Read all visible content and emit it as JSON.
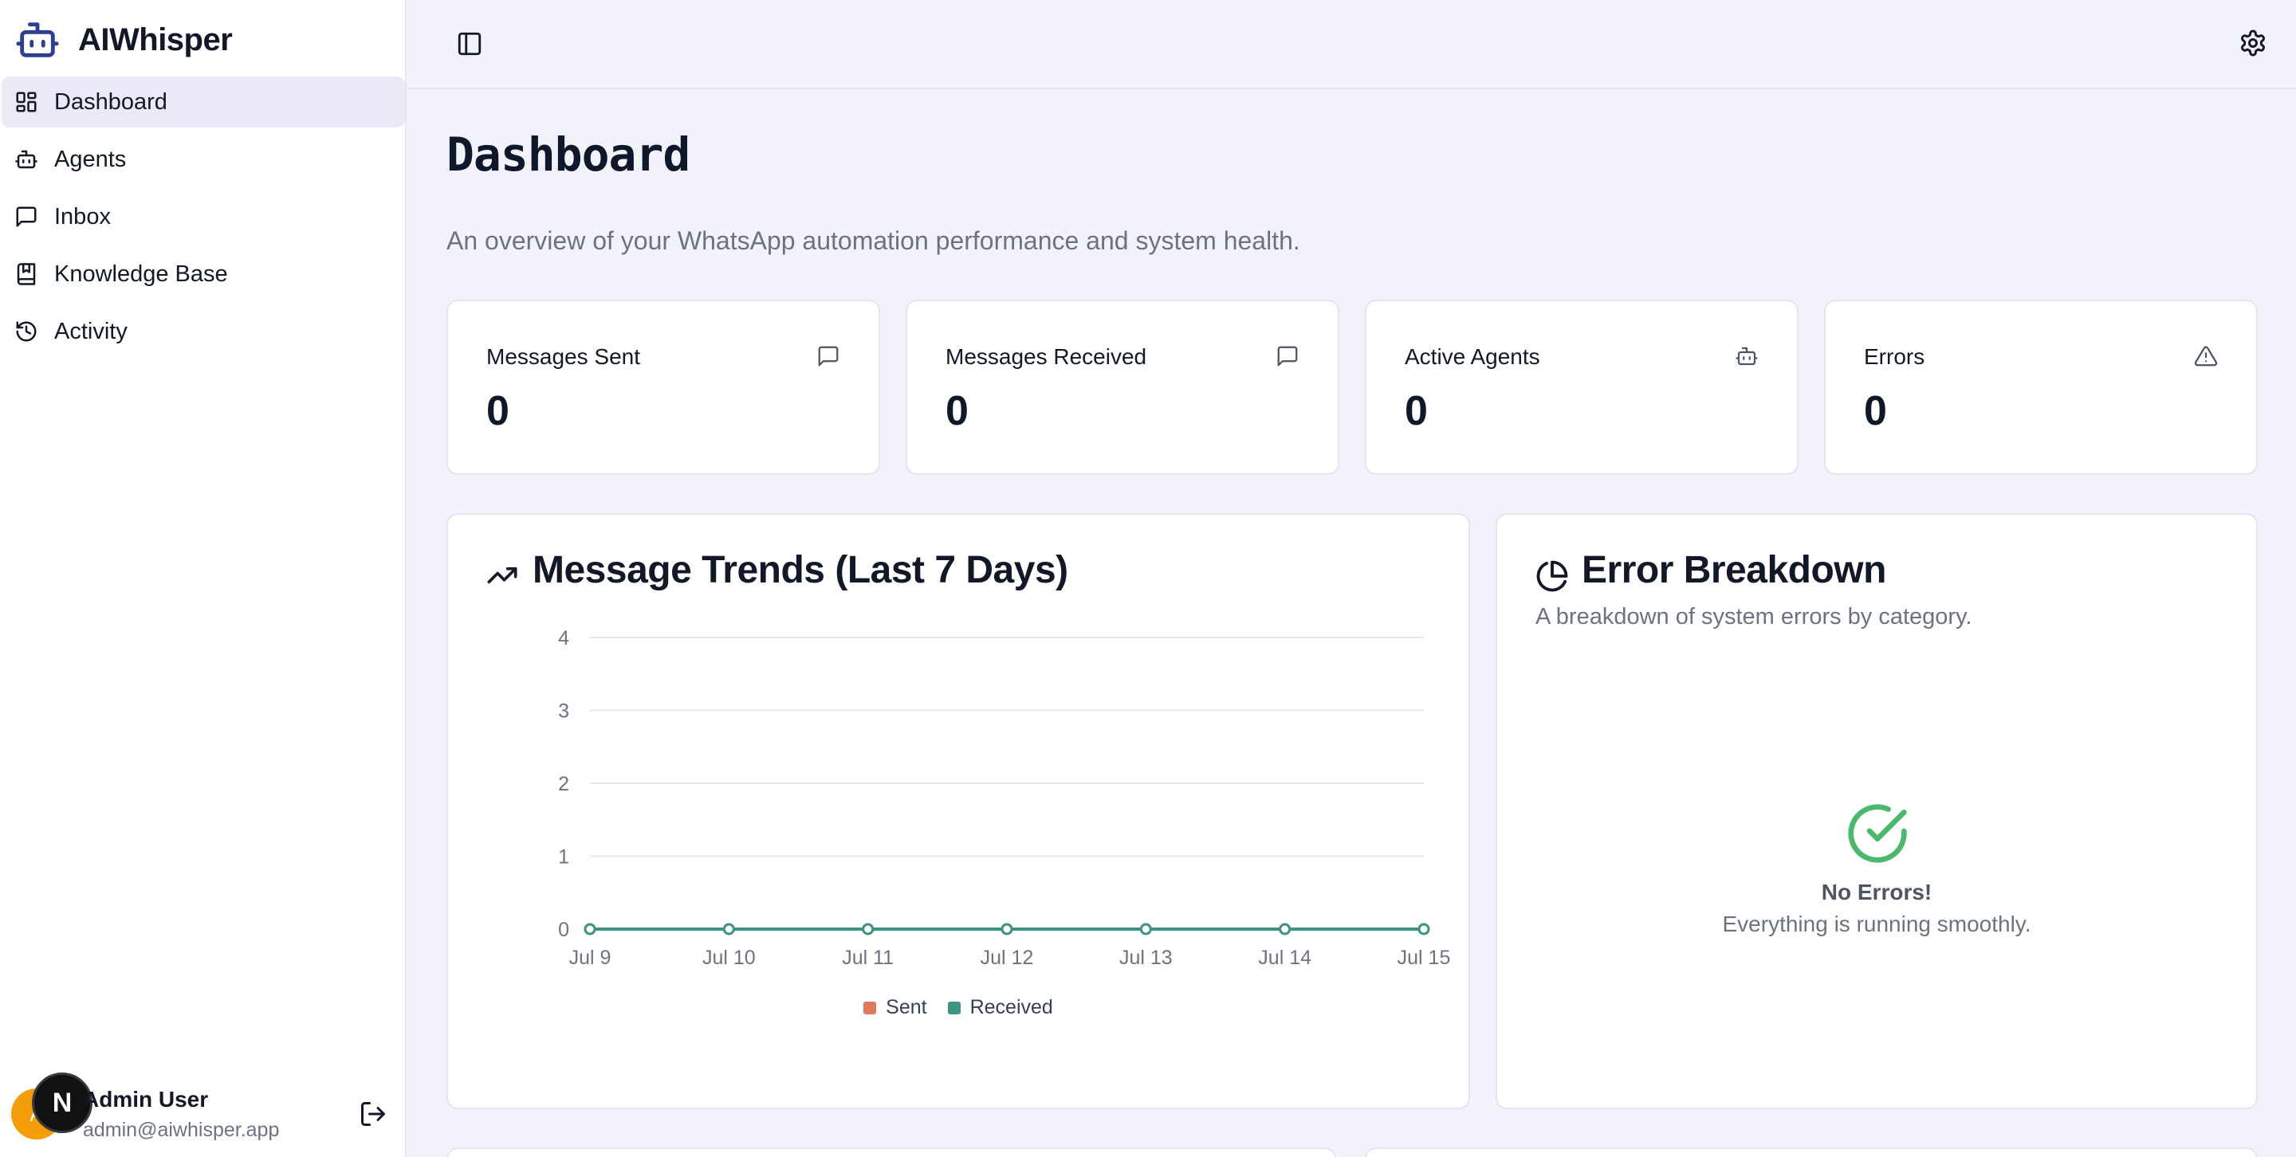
{
  "app": {
    "name": "AIWhisper"
  },
  "sidebar": {
    "items": [
      {
        "label": "Dashboard",
        "icon": "layout-dashboard-icon",
        "active": true
      },
      {
        "label": "Agents",
        "icon": "bot-icon",
        "active": false
      },
      {
        "label": "Inbox",
        "icon": "message-square-icon",
        "active": false
      },
      {
        "label": "Knowledge Base",
        "icon": "book-icon",
        "active": false
      },
      {
        "label": "Activity",
        "icon": "history-icon",
        "active": false
      }
    ],
    "user": {
      "initials": "A",
      "name": "Admin User",
      "email": "admin@aiwhisper.app"
    },
    "dev_badge": "N"
  },
  "page": {
    "title": "Dashboard",
    "subtitle": "An overview of your WhatsApp automation performance and system health."
  },
  "stats": [
    {
      "label": "Messages Sent",
      "value": "0",
      "icon": "message-square-icon"
    },
    {
      "label": "Messages Received",
      "value": "0",
      "icon": "message-square-icon"
    },
    {
      "label": "Active Agents",
      "value": "0",
      "icon": "bot-icon"
    },
    {
      "label": "Errors",
      "value": "0",
      "icon": "alert-triangle-icon"
    }
  ],
  "trends": {
    "title": "Message Trends (Last 7 Days)",
    "icon": "trending-up-icon"
  },
  "errors": {
    "title": "Error Breakdown",
    "subtitle": "A breakdown of system errors by category.",
    "empty_title": "No Errors!",
    "empty_text": "Everything is running smoothly.",
    "icon": "pie-chart-icon"
  },
  "colors": {
    "sent": "#e07a5f",
    "received": "#3d9485",
    "success": "#4cb86b",
    "avatar": "#f59e0b"
  },
  "chart_data": {
    "type": "line",
    "categories": [
      "Jul 9",
      "Jul 10",
      "Jul 11",
      "Jul 12",
      "Jul 13",
      "Jul 14",
      "Jul 15"
    ],
    "series": [
      {
        "name": "Sent",
        "values": [
          0,
          0,
          0,
          0,
          0,
          0,
          0
        ]
      },
      {
        "name": "Received",
        "values": [
          0,
          0,
          0,
          0,
          0,
          0,
          0
        ]
      }
    ],
    "yticks": [
      0,
      1,
      2,
      3,
      4
    ],
    "ylim": [
      0,
      4
    ],
    "grid": true,
    "legend": "bottom-center"
  }
}
